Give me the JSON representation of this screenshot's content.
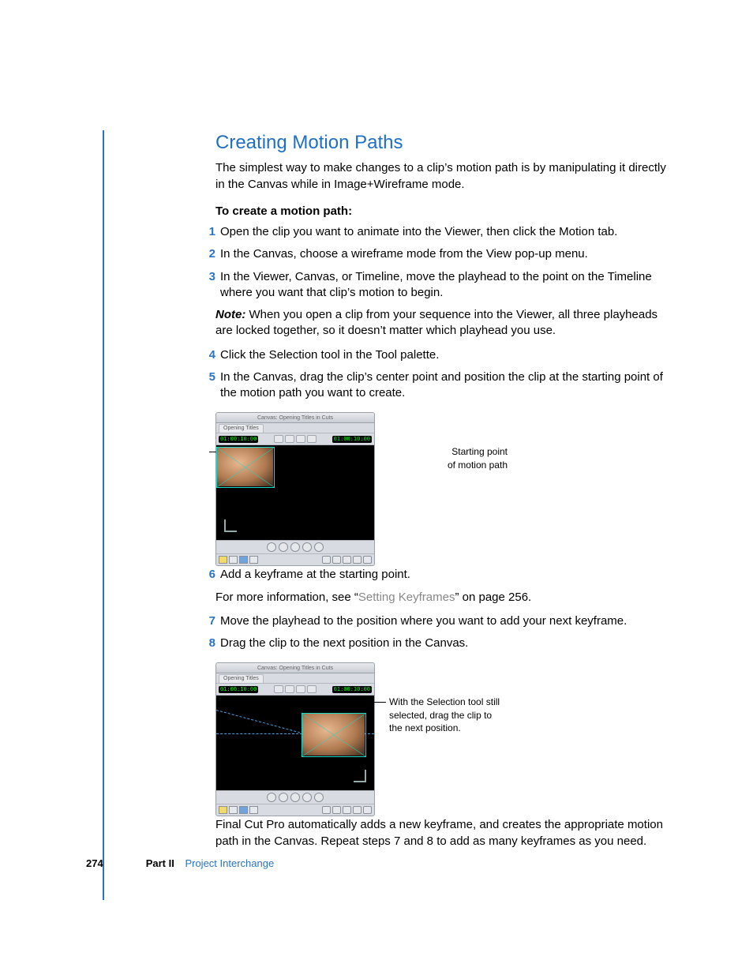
{
  "heading": "Creating Motion Paths",
  "intro": "The simplest way to make changes to a clip’s motion path is by manipulating it directly in the Canvas while in Image+Wireframe mode.",
  "lead": "To create a motion path:",
  "steps": {
    "s1": "Open the clip you want to animate into the Viewer, then click the Motion tab.",
    "s2": "In the Canvas, choose a wireframe mode from the View pop-up menu.",
    "s3": "In the Viewer, Canvas, or Timeline, move the playhead to the point on the Timeline where you want that clip’s motion to begin.",
    "note_label": "Note:",
    "note_body": "  When you open a clip from your sequence into the Viewer, all three playheads are locked together, so it doesn’t matter which playhead you use.",
    "s4": "Click the Selection tool in the Tool palette.",
    "s5": "In the Canvas, drag the clip’s center point and position the clip at the starting point of the motion path you want to create.",
    "s6": "Add a keyframe at the starting point.",
    "s6b_pre": "For more information, see “",
    "s6b_link": "Setting Keyframes",
    "s6b_post": "” on page 256.",
    "s7": "Move the playhead to the position where you want to add your next keyframe.",
    "s8": "Drag the clip to the next position in the Canvas."
  },
  "callouts": {
    "left_l1": "Starting point",
    "left_l2": "of motion path",
    "right": "With the Selection tool still selected, drag the clip to the next position."
  },
  "fig": {
    "title": "Canvas: Opening Titles in Cuts",
    "tab": "Opening Titles",
    "tc_left": "01:00:10:00",
    "tc_right": "01:00:10:00"
  },
  "closing": "Final Cut Pro automatically adds a new keyframe, and creates the appropriate motion path in the Canvas. Repeat steps 7 and 8 to add as many keyframes as you need.",
  "footer": {
    "page": "274",
    "part": "Part II",
    "section": "Project Interchange"
  },
  "nums": {
    "n1": "1",
    "n2": "2",
    "n3": "3",
    "n4": "4",
    "n5": "5",
    "n6": "6",
    "n7": "7",
    "n8": "8"
  }
}
